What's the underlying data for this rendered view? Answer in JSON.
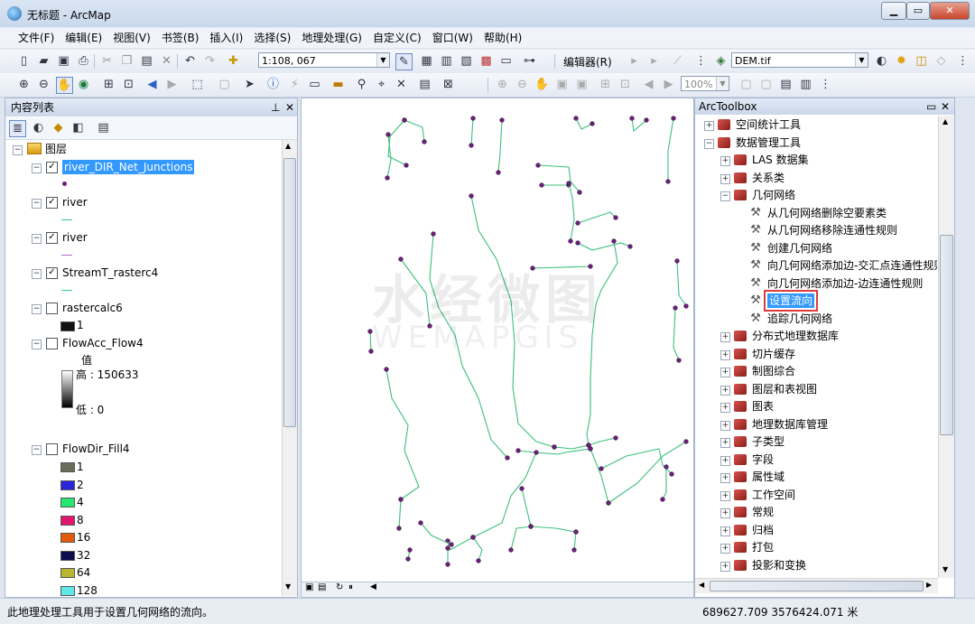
{
  "window": {
    "title": "无标题 - ArcMap"
  },
  "menu": [
    "文件(F)",
    "编辑(E)",
    "视图(V)",
    "书签(B)",
    "插入(I)",
    "选择(S)",
    "地理处理(G)",
    "自定义(C)",
    "窗口(W)",
    "帮助(H)"
  ],
  "toolbar": {
    "scale": "1:108, 067",
    "editor_label": "编辑器(R)",
    "layer_combo": "DEM.tif",
    "zoom_combo": "100%"
  },
  "toc": {
    "title": "内容列表",
    "root": "图层",
    "layers": [
      {
        "name": "river_DIR_Net_Junctions",
        "checked": true
      },
      {
        "name": "river",
        "checked": true
      },
      {
        "name": "river",
        "checked": true
      },
      {
        "name": "StreamT_rasterc4",
        "checked": true
      },
      {
        "name": "rastercalc6",
        "checked": false
      },
      {
        "name": "FlowAcc_Flow4",
        "checked": false
      },
      {
        "name": "FlowDir_Fill4",
        "checked": false
      }
    ],
    "rastercalc_value": "1",
    "flowacc_legend": {
      "title": "值",
      "high": "高 : 150633",
      "low": "低 : 0"
    },
    "flowdir_classes": [
      "1",
      "2",
      "4",
      "8",
      "16",
      "32",
      "64",
      "128"
    ],
    "flowdir_colors": [
      "#6b6b5a",
      "#2a25d9",
      "#26e870",
      "#e0166e",
      "#e35a0c",
      "#0c0c4e",
      "#b8b62e",
      "#5ee8e8"
    ]
  },
  "map": {
    "watermark_cn": "水经微图",
    "watermark_en": "WEMAPGIS",
    "river_color": "#3cc07a",
    "junction_color": "#6b1f7a"
  },
  "toolbox": {
    "title": "ArcToolbox",
    "items": [
      {
        "label": "空间统计工具",
        "kind": "toolbox",
        "level": 0,
        "expander": "+"
      },
      {
        "label": "数据管理工具",
        "kind": "toolbox",
        "level": 0,
        "expander": "-"
      },
      {
        "label": "LAS 数据集",
        "kind": "toolset",
        "level": 1,
        "expander": "+"
      },
      {
        "label": "关系类",
        "kind": "toolset",
        "level": 1,
        "expander": "+"
      },
      {
        "label": "几何网络",
        "kind": "toolset",
        "level": 1,
        "expander": "-"
      },
      {
        "label": "从几何网络删除空要素类",
        "kind": "tool",
        "level": 2
      },
      {
        "label": "从几何网络移除连通性规则",
        "kind": "tool",
        "level": 2
      },
      {
        "label": "创建几何网络",
        "kind": "tool",
        "level": 2
      },
      {
        "label": "向几何网络添加边-交汇点连通性规则",
        "kind": "tool",
        "level": 2
      },
      {
        "label": "向几何网络添加边-边连通性规则",
        "kind": "tool",
        "level": 2
      },
      {
        "label": "设置流向",
        "kind": "tool",
        "level": 2,
        "selected": true
      },
      {
        "label": "追踪几何网络",
        "kind": "tool",
        "level": 2
      },
      {
        "label": "分布式地理数据库",
        "kind": "toolset",
        "level": 1,
        "expander": "+"
      },
      {
        "label": "切片缓存",
        "kind": "toolset",
        "level": 1,
        "expander": "+"
      },
      {
        "label": "制图综合",
        "kind": "toolset",
        "level": 1,
        "expander": "+"
      },
      {
        "label": "图层和表视图",
        "kind": "toolset",
        "level": 1,
        "expander": "+"
      },
      {
        "label": "图表",
        "kind": "toolset",
        "level": 1,
        "expander": "+"
      },
      {
        "label": "地理数据库管理",
        "kind": "toolset",
        "level": 1,
        "expander": "+"
      },
      {
        "label": "子类型",
        "kind": "toolset",
        "level": 1,
        "expander": "+"
      },
      {
        "label": "字段",
        "kind": "toolset",
        "level": 1,
        "expander": "+"
      },
      {
        "label": "属性域",
        "kind": "toolset",
        "level": 1,
        "expander": "+"
      },
      {
        "label": "工作空间",
        "kind": "toolset",
        "level": 1,
        "expander": "+"
      },
      {
        "label": "常规",
        "kind": "toolset",
        "level": 1,
        "expander": "+"
      },
      {
        "label": "归档",
        "kind": "toolset",
        "level": 1,
        "expander": "+"
      },
      {
        "label": "打包",
        "kind": "toolset",
        "level": 1,
        "expander": "+"
      },
      {
        "label": "投影和变换",
        "kind": "toolset",
        "level": 1,
        "expander": "+"
      }
    ]
  },
  "status": {
    "message": "此地理处理工具用于设置几何网络的流向。",
    "coords": "689627.709  3576424.071 米"
  }
}
